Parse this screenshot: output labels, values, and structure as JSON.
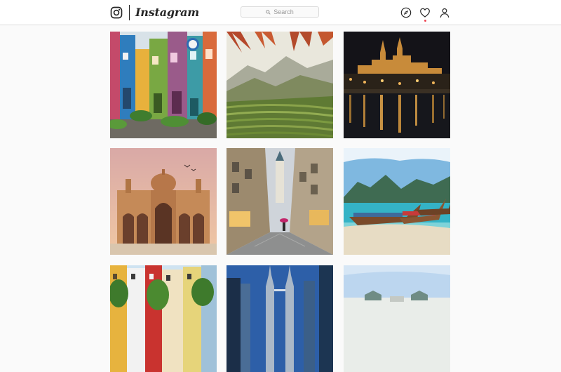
{
  "header": {
    "app_name": "Instagram",
    "search_placeholder": "Search",
    "icons": [
      "instagram-logo-icon",
      "search-icon",
      "explore-compass-icon",
      "activity-heart-icon",
      "profile-icon"
    ],
    "notification_dot_color": "#ed4956"
  },
  "posts": [
    {
      "subject": "colorful-alley-shopfronts"
    },
    {
      "subject": "mountain-rice-terraces"
    },
    {
      "subject": "castle-night-river-reflection"
    },
    {
      "subject": "sandstone-mausoleum-sunset"
    },
    {
      "subject": "old-town-rainy-street"
    },
    {
      "subject": "longtail-boats-tropical-beach"
    },
    {
      "subject": "colorful-townhouses-trees"
    },
    {
      "subject": "twin-towers-skyline"
    },
    {
      "subject": "white-palace-sky"
    }
  ],
  "colors": {
    "background": "#fafafa",
    "header_background": "#ffffff",
    "border": "#dbdbdb",
    "text_dark": "#262626",
    "placeholder_text": "#999999"
  }
}
